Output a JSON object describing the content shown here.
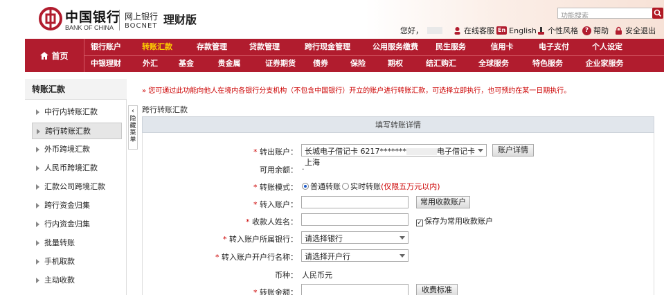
{
  "header": {
    "logo_cn": "中国银行",
    "logo_en": "BANK OF CHINA",
    "sub_cn": "网上银行",
    "sub_en": "BOCNET",
    "version": "理财版",
    "search_placeholder": "功能搜索",
    "greeting": "您好，",
    "links": {
      "service": "在线客服",
      "english": "English",
      "style": "个性风格",
      "help": "帮助",
      "logout": "安全退出"
    },
    "english_badge": "En"
  },
  "nav": {
    "home": "首页",
    "row1": [
      "银行账户",
      "转账汇款",
      "存款管理",
      "贷款管理",
      "跨行现金管理",
      "公用服务缴费",
      "民生服务",
      "信用卡",
      "电子支付",
      "个人设定"
    ],
    "row2": [
      "中银理财",
      "外汇",
      "基金",
      "贵金属",
      "证券期货",
      "债券",
      "保险",
      "期权",
      "结汇购汇",
      "全球服务",
      "特色服务",
      "企业家服务"
    ],
    "active": "转账汇款"
  },
  "sidebar": {
    "title": "转账汇款",
    "items": [
      "中行内转账汇款",
      "跨行转账汇款",
      "外币跨境汇款",
      "人民币跨境汇款",
      "汇款公司跨境汇款",
      "跨行资金归集",
      "行内资金归集",
      "批量转账",
      "手机取款",
      "主动收款"
    ],
    "active_index": 1,
    "collapse_label": "隐藏菜单"
  },
  "main": {
    "notice": "» 您可通过此功能向他人在境内各银行分支机构（不包含中国银行）开立的账户进行转账汇款，可选择立即执行，也可预约在某一日期执行。",
    "section_title": "跨行转账汇款",
    "card_title": "填写转账详情",
    "fields": {
      "from_account_label": "转出账户：",
      "from_account_value": "长城电子借记卡 6217*******",
      "from_account_value2": "电子借记卡 上海",
      "account_detail_btn": "账户详情",
      "balance_label": "可用余额：",
      "balance_value": ".",
      "mode_label": "转账模式：",
      "mode_normal": "普通转账",
      "mode_realtime": "实时转账",
      "mode_realtime_note": "(仅限五万元以内)",
      "to_account_label": "转入账户：",
      "common_payee_btn": "常用收款账户",
      "payee_name_label": "收款人姓名：",
      "save_payee_label": "保存为常用收款账户",
      "bank_label": "转入账户所属银行：",
      "bank_placeholder": "请选择银行",
      "branch_label": "转入账户开户行名称：",
      "branch_placeholder": "请选择开户行",
      "currency_label": "币种：",
      "currency_value": "人民币元",
      "amount_label": "转账金额：",
      "fee_btn": "收费标准"
    }
  },
  "colors": {
    "brand_red": "#b11c2e",
    "nav_active": "#ffd400"
  }
}
